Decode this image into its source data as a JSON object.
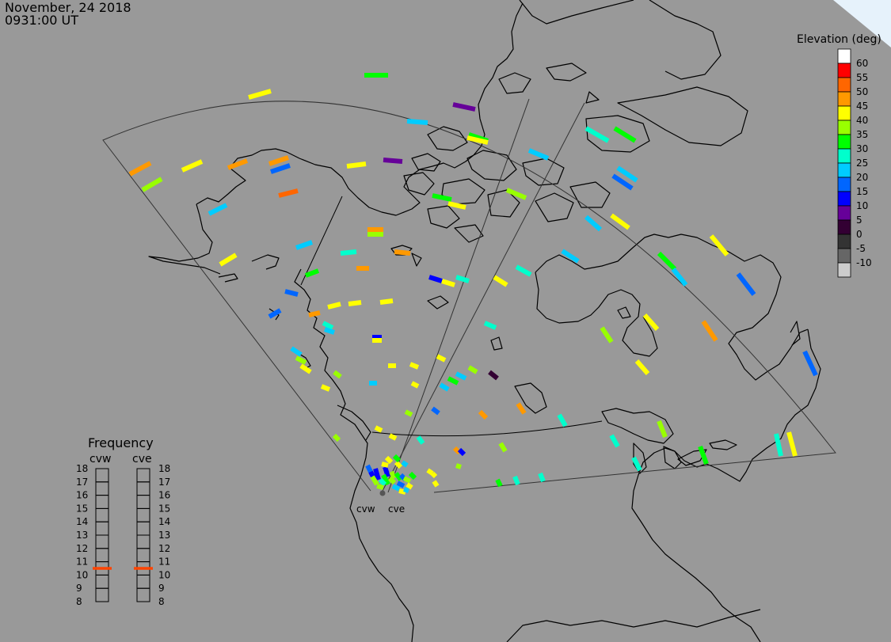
{
  "header": {
    "date": "November, 24 2018",
    "time": "0931:00 UT"
  },
  "radars": [
    {
      "code": "cvw"
    },
    {
      "code": "cve"
    }
  ],
  "elevation_scale": {
    "title": "Elevation (deg)",
    "levels": [
      {
        "label": "60",
        "color": "#ffffff"
      },
      {
        "label": "55",
        "color": "#ff0000"
      },
      {
        "label": "50",
        "color": "#ff6600"
      },
      {
        "label": "45",
        "color": "#ff9900"
      },
      {
        "label": "40",
        "color": "#ffff00"
      },
      {
        "label": "35",
        "color": "#99ff00"
      },
      {
        "label": "30",
        "color": "#00ff00"
      },
      {
        "label": "25",
        "color": "#00ffcc"
      },
      {
        "label": "20",
        "color": "#00ccff"
      },
      {
        "label": "15",
        "color": "#0066ff"
      },
      {
        "label": "10",
        "color": "#0000ff"
      },
      {
        "label": "5",
        "color": "#660099"
      },
      {
        "label": "0",
        "color": "#330033"
      },
      {
        "label": "-5",
        "color": "#333333"
      },
      {
        "label": "-10",
        "color": "#666666"
      },
      {
        "label": "",
        "color": "#cccccc"
      }
    ]
  },
  "frequency": {
    "title": "Frequency",
    "left_label": "cvw",
    "right_label": "cve",
    "ticks": [
      "18",
      "17",
      "16",
      "15",
      "14",
      "13",
      "12",
      "11",
      "10",
      "9",
      "8"
    ],
    "cvw_mhz": 10.5,
    "cve_mhz": 10.5,
    "marker_color": "#ff4400"
  }
}
